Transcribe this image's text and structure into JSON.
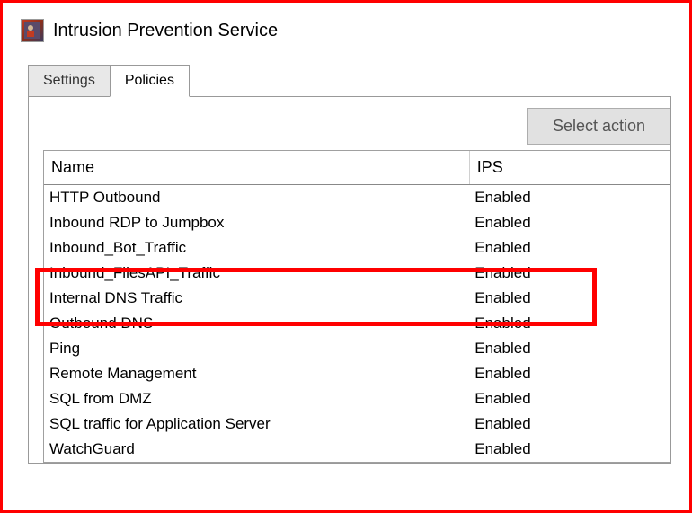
{
  "app": {
    "title": "Intrusion Prevention Service"
  },
  "tabs": {
    "settings_label": "Settings",
    "policies_label": "Policies",
    "active": "Policies"
  },
  "actions": {
    "select_action_label": "Select action"
  },
  "table": {
    "headers": {
      "name": "Name",
      "ips": "IPS"
    },
    "rows": [
      {
        "name": "HTTP Outbound",
        "ips": "Enabled"
      },
      {
        "name": "Inbound RDP to Jumpbox",
        "ips": "Enabled"
      },
      {
        "name": "Inbound_Bot_Traffic",
        "ips": "Enabled"
      },
      {
        "name": "Inbound_FilesAPI_Traffic",
        "ips": "Enabled"
      },
      {
        "name": "Internal DNS Traffic",
        "ips": "Enabled"
      },
      {
        "name": "Outbound DNS",
        "ips": "Enabled"
      },
      {
        "name": "Ping",
        "ips": "Enabled"
      },
      {
        "name": "Remote Management",
        "ips": "Enabled"
      },
      {
        "name": "SQL from DMZ",
        "ips": "Enabled"
      },
      {
        "name": "SQL traffic for Application Server",
        "ips": "Enabled"
      },
      {
        "name": "WatchGuard",
        "ips": "Enabled"
      }
    ]
  },
  "highlighted_rows": [
    2,
    3
  ]
}
